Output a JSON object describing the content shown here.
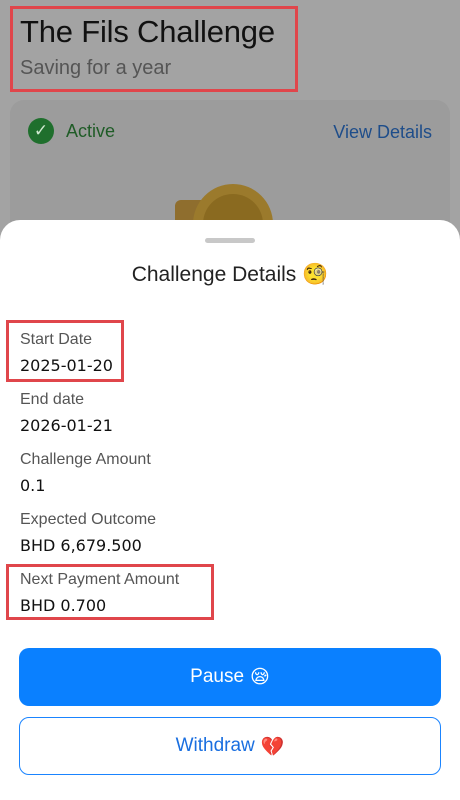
{
  "screen": {
    "title": "The Fils Challenge",
    "subtitle": "Saving for a year"
  },
  "card": {
    "status_label": "Active",
    "view_details_label": "View Details",
    "status_icon": "check-circle-icon",
    "status_color": "#34a853"
  },
  "sheet": {
    "title": "Challenge Details",
    "title_emoji": "🧐",
    "fields": [
      {
        "label": "Start Date",
        "value": "2025-01-20"
      },
      {
        "label": "End date",
        "value": "2026-01-21"
      },
      {
        "label": "Challenge Amount",
        "value": "0.1"
      },
      {
        "label": "Expected Outcome",
        "value": "BHD 6,679.500"
      },
      {
        "label": "Next Payment Amount",
        "value": "BHD 0.700"
      }
    ],
    "pause_label": "Pause",
    "pause_emoji": "😪",
    "withdraw_label": "Withdraw",
    "withdraw_emoji": "💔"
  },
  "colors": {
    "primary": "#0a80ff",
    "highlight": "#e0464b"
  }
}
